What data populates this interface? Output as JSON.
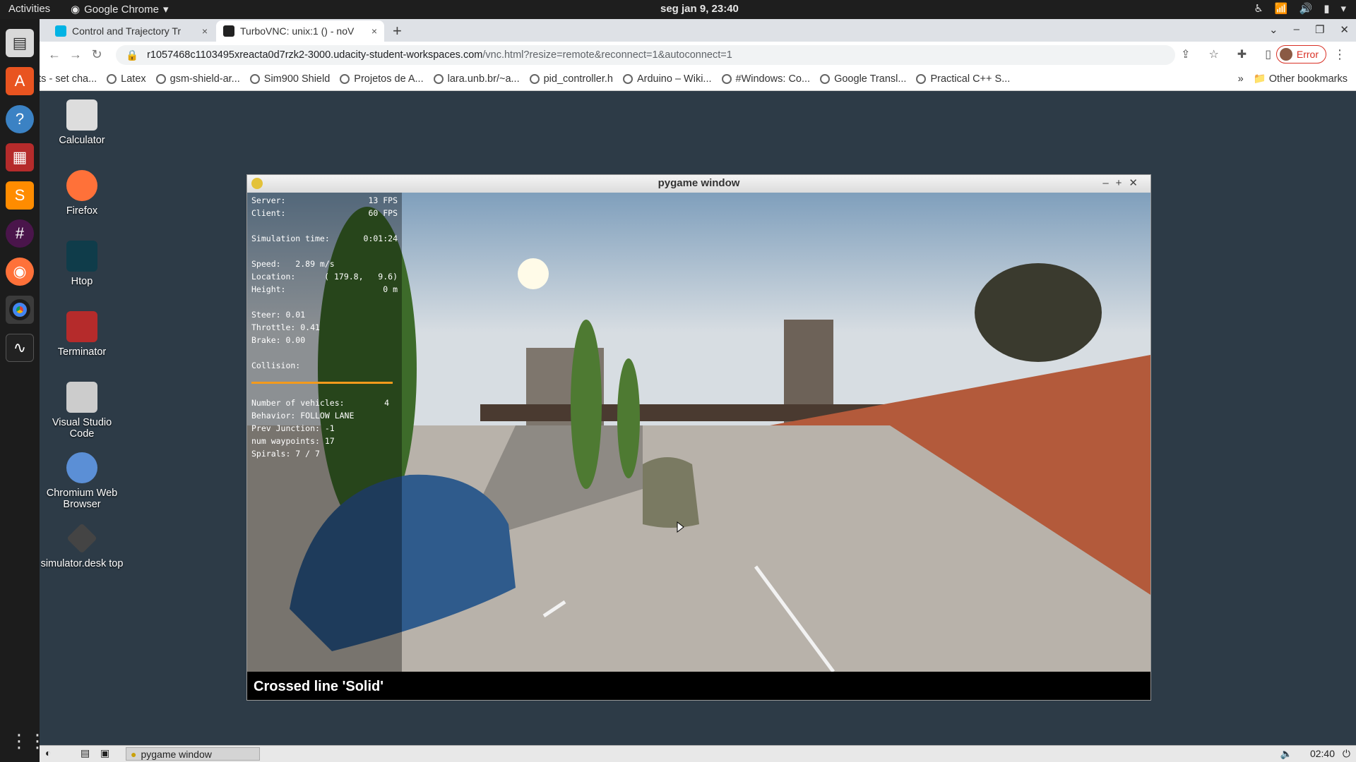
{
  "topbar": {
    "activities": "Activities",
    "app": "Google Chrome",
    "clock": "seg jan  9, 23:40"
  },
  "tabs": [
    {
      "label": "Control and Trajectory Tr",
      "close": "×"
    },
    {
      "label": "TurboVNC: unix:1 () - noV",
      "close": "×"
    }
  ],
  "address": {
    "host": "r1057468c1103495xreacta0d7rzk2-3000.udacity-student-workspaces.com",
    "path": "/vnc.html?resize=remote&reconnect=1&autoconnect=1"
  },
  "profile": {
    "label": "Error"
  },
  "bookmarks": [
    "fonts - set cha...",
    "Latex",
    "gsm-shield-ar...",
    "Sim900 Shield",
    "Projetos de A...",
    "lara.unb.br/~a...",
    "pid_controller.h",
    "Arduino – Wiki...",
    "#Windows: Co...",
    "Google Transl...",
    "Practical C++ S..."
  ],
  "other_bookmarks": "Other bookmarks",
  "desktop_icons": [
    "Calculator",
    "Firefox",
    "Htop",
    "Terminator",
    "Visual Studio Code",
    "Chromium Web Browser",
    "simulator.desk top"
  ],
  "pygame": {
    "title": "pygame window",
    "hud": {
      "server_label": "Server:",
      "server": "13 FPS",
      "client_label": "Client:",
      "client": "60 FPS",
      "simtime_label": "Simulation time:",
      "simtime": "0:01:24",
      "speed": "Speed:   2.89 m/s",
      "location_label": "Location:",
      "location": "( 179.8,   9.6)",
      "height_label": "Height:",
      "height": "0 m",
      "steer": "Steer: 0.01",
      "throttle": "Throttle: 0.41",
      "brake": "Brake: 0.00",
      "collision": "Collision:",
      "vehicles_label": "Number of vehicles:",
      "vehicles": "4",
      "behavior": "Behavior: FOLLOW LANE",
      "junction": "Prev Junction: -1",
      "waypoints": "num waypoints: 17",
      "spirals": "Spirals: 7 / 7"
    },
    "message": "Crossed line 'Solid'"
  },
  "taskbar": {
    "task": "pygame window",
    "clock": "02:40"
  },
  "colors": {
    "hud_bar": "#f39a1c",
    "profile_error": "#d93025"
  }
}
